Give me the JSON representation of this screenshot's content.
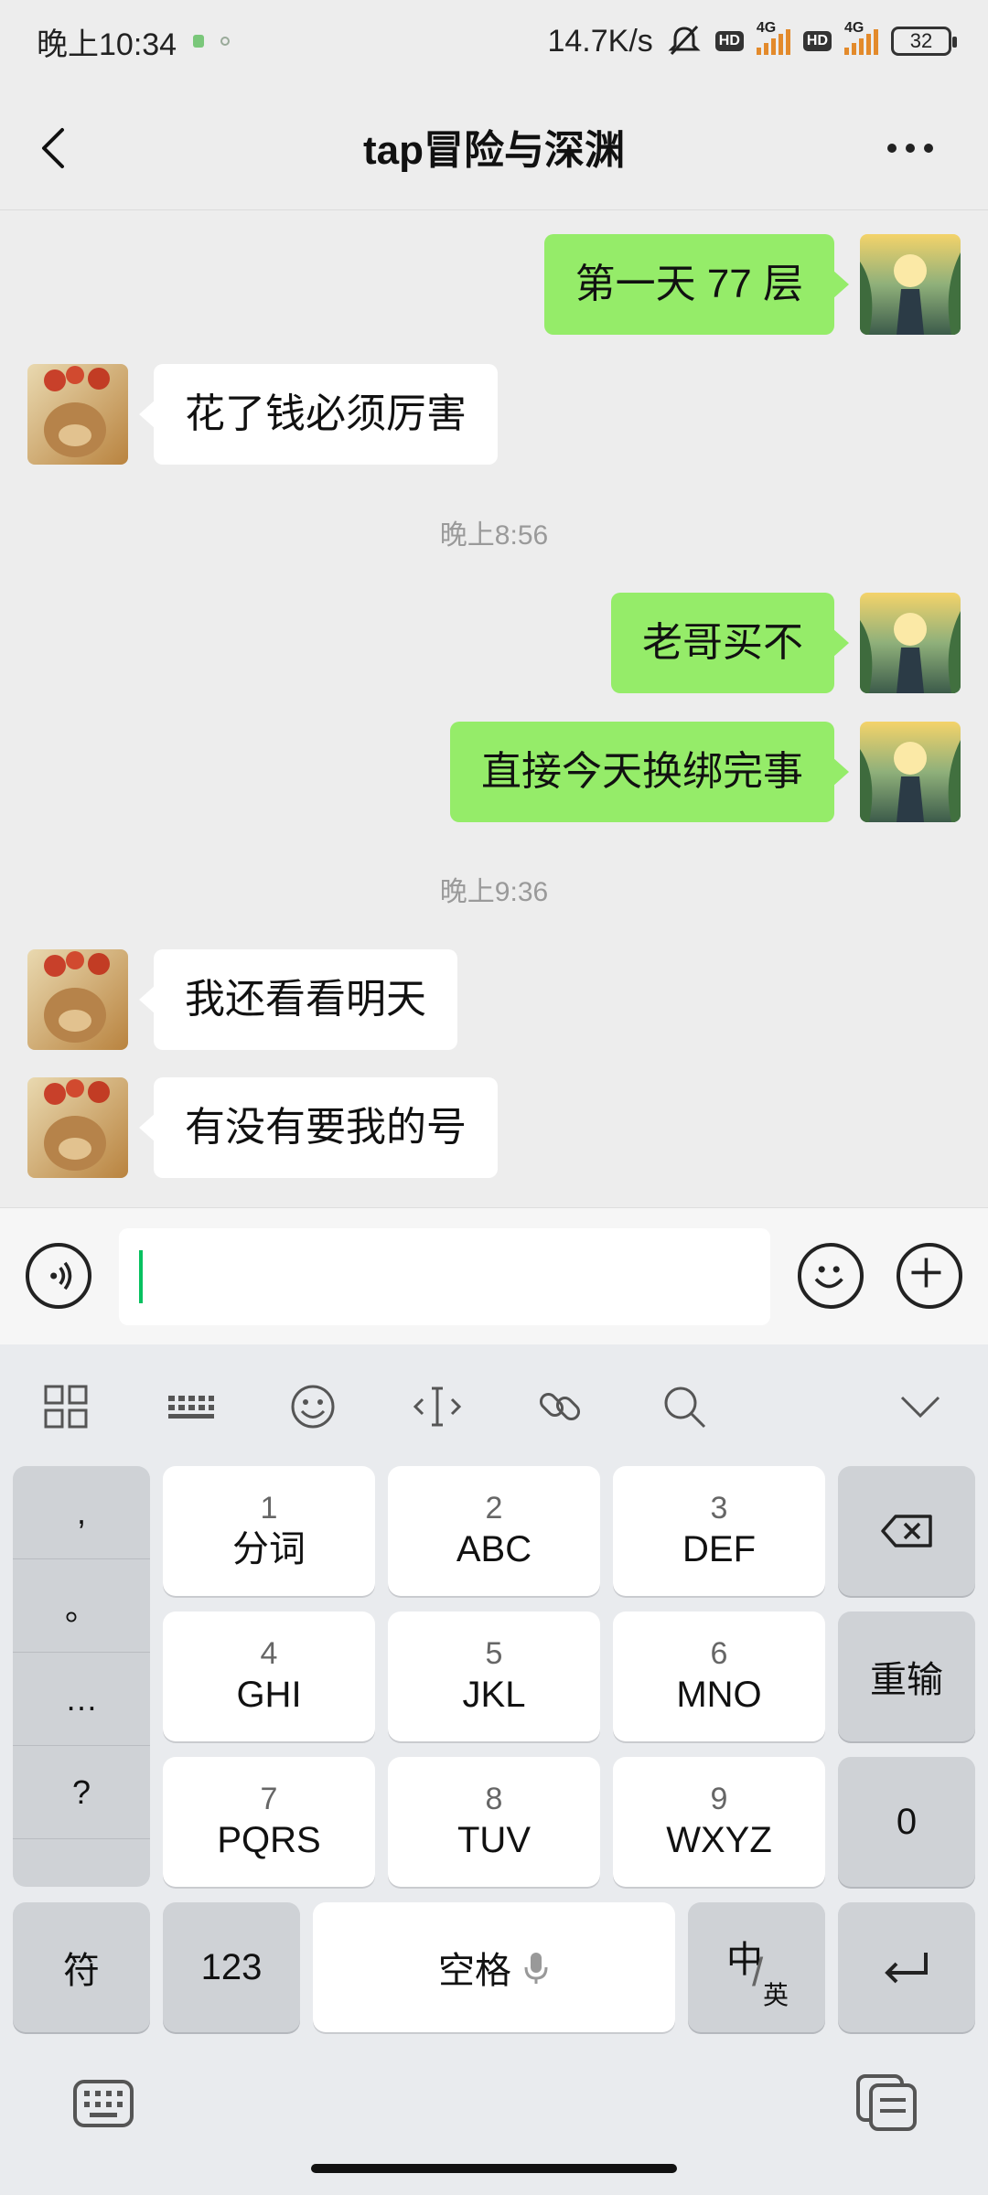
{
  "status": {
    "time": "晚上10:34",
    "speed": "14.7K/s",
    "net1": "4G",
    "net2": "4G",
    "battery": "32",
    "hd": "HD"
  },
  "header": {
    "title": "tap冒险与深渊"
  },
  "messages": [
    {
      "from": "me",
      "text": "第一天 77 层"
    },
    {
      "from": "other",
      "text": "花了钱必须厉害"
    },
    {
      "type": "time",
      "text": "晚上8:56"
    },
    {
      "from": "me",
      "text": "老哥买不"
    },
    {
      "from": "me",
      "text": "直接今天换绑完事"
    },
    {
      "type": "time",
      "text": "晚上9:36"
    },
    {
      "from": "other",
      "text": "我还看看明天"
    },
    {
      "from": "other",
      "text": "有没有要我的号"
    }
  ],
  "input": {
    "value": ""
  },
  "keyboard": {
    "punct": [
      ",",
      "。",
      "…",
      "?"
    ],
    "keys": [
      {
        "num": "1",
        "letters": "分词"
      },
      {
        "num": "2",
        "letters": "ABC"
      },
      {
        "num": "3",
        "letters": "DEF"
      },
      {
        "num": "4",
        "letters": "GHI"
      },
      {
        "num": "5",
        "letters": "JKL"
      },
      {
        "num": "6",
        "letters": "MNO"
      },
      {
        "num": "7",
        "letters": "PQRS"
      },
      {
        "num": "8",
        "letters": "TUV"
      },
      {
        "num": "9",
        "letters": "WXYZ"
      }
    ],
    "reinput": "重输",
    "zero": "0",
    "symbol": "符",
    "num123": "123",
    "space": "空格",
    "lang_zh": "中",
    "lang_en": "英"
  }
}
